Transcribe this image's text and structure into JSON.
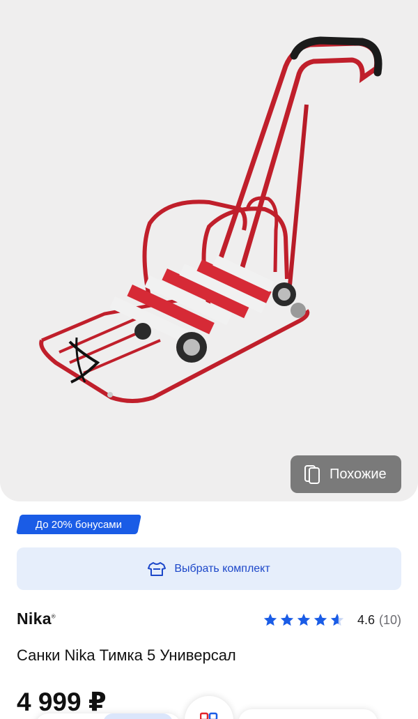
{
  "gallery": {
    "image_alt": "sled-product-photo",
    "similar_label": "Похожие",
    "similar_icon": "cards-icon"
  },
  "promo": {
    "bonus_label": "До 20% бонусами",
    "kit_label": "Выбрать комплект",
    "kit_icon": "tshirt-icon"
  },
  "product": {
    "brand": "Nika",
    "brand_mark": "®",
    "title": "Санки Nika Тимка 5 Универсал",
    "price": "4 999 ₽",
    "rating": {
      "value": "4.6",
      "count": "(10)",
      "stars": 4.6,
      "stars_max": 5
    }
  },
  "colors": {
    "accent": "#1a5ce6",
    "accent_text": "#1c47c9",
    "accent_light": "#e6eefb",
    "sled_red": "#c8202c",
    "star": "#1a5ce6"
  }
}
